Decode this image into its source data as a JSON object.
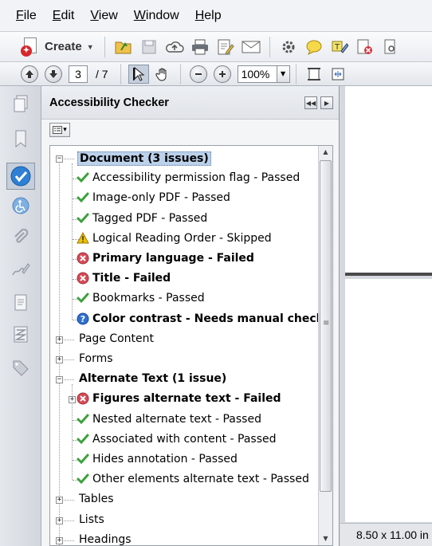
{
  "menu": {
    "items": [
      {
        "label": "File",
        "key": "F"
      },
      {
        "label": "Edit",
        "key": "E"
      },
      {
        "label": "View",
        "key": "V"
      },
      {
        "label": "Window",
        "key": "W"
      },
      {
        "label": "Help",
        "key": "H"
      }
    ]
  },
  "toolbar": {
    "create_label": "Create"
  },
  "navigation": {
    "current_page": "3",
    "page_total": "/ 7",
    "zoom": "100%"
  },
  "panel": {
    "title": "Accessibility Checker",
    "rows": [
      {
        "label": "Document (3 issues)",
        "status": "none",
        "bold": true,
        "selected": true,
        "expander": "minus",
        "level": 0
      },
      {
        "label": "Accessibility permission flag - Passed",
        "status": "passed",
        "bold": false,
        "level": 1
      },
      {
        "label": "Image-only PDF - Passed",
        "status": "passed",
        "bold": false,
        "level": 1
      },
      {
        "label": "Tagged PDF - Passed",
        "status": "passed",
        "bold": false,
        "level": 1
      },
      {
        "label": "Logical Reading Order - Skipped",
        "status": "skipped",
        "bold": false,
        "level": 1
      },
      {
        "label": "Primary language - Failed",
        "status": "failed",
        "bold": true,
        "level": 1
      },
      {
        "label": "Title - Failed",
        "status": "failed",
        "bold": true,
        "level": 1
      },
      {
        "label": "Bookmarks - Passed",
        "status": "passed",
        "bold": false,
        "level": 1
      },
      {
        "label": "Color contrast - Needs manual check",
        "status": "manual",
        "bold": true,
        "level": 1
      },
      {
        "label": "Page Content",
        "status": "none",
        "bold": false,
        "expander": "plus",
        "level": 0
      },
      {
        "label": "Forms",
        "status": "none",
        "bold": false,
        "expander": "plus",
        "level": 0
      },
      {
        "label": "Alternate Text (1 issue)",
        "status": "none",
        "bold": true,
        "expander": "minus",
        "level": 0
      },
      {
        "label": "Figures alternate text - Failed",
        "status": "failed",
        "bold": true,
        "expander": "plus",
        "level": 1
      },
      {
        "label": "Nested alternate text - Passed",
        "status": "passed",
        "bold": false,
        "level": 1
      },
      {
        "label": "Associated with content - Passed",
        "status": "passed",
        "bold": false,
        "level": 1
      },
      {
        "label": "Hides annotation - Passed",
        "status": "passed",
        "bold": false,
        "level": 1
      },
      {
        "label": "Other elements alternate text - Passed",
        "status": "passed",
        "bold": false,
        "level": 1
      },
      {
        "label": "Tables",
        "status": "none",
        "bold": false,
        "expander": "plus",
        "level": 0
      },
      {
        "label": "Lists",
        "status": "none",
        "bold": false,
        "expander": "plus",
        "level": 0
      },
      {
        "label": "Headings",
        "status": "none",
        "bold": false,
        "expander": "plus",
        "level": 0
      }
    ]
  },
  "document": {
    "page_size": "8.50 x 11.00 in"
  },
  "colors": {
    "passed": "#3aa23a",
    "failed": "#d64a55",
    "skipped": "#f2c200",
    "manual": "#2f6fd0",
    "selection": "#bcd1ea"
  }
}
